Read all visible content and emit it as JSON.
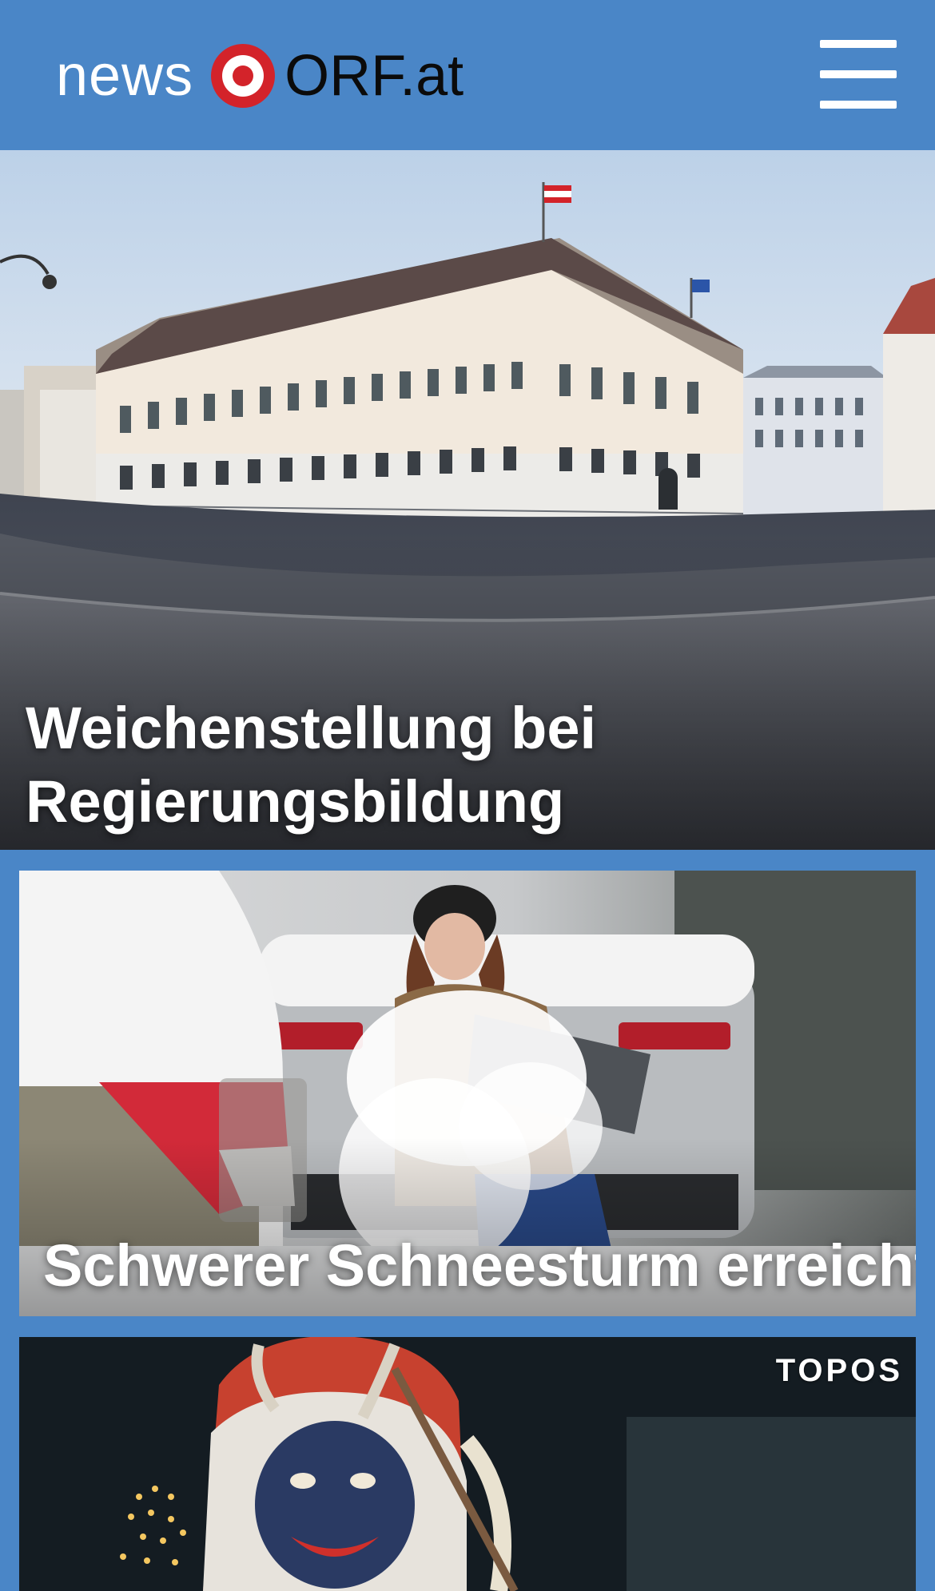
{
  "header": {
    "logo_word": "news",
    "logo_brand": "ORF.at",
    "menu_icon": "hamburger-menu-icon"
  },
  "colors": {
    "header_bg": "#4a86c7",
    "logo_red": "#d3232a",
    "text_white": "#ffffff"
  },
  "stories": {
    "lead": {
      "title_line1": "Weichenstellung bei",
      "title_line2": "Regierungsbildung"
    },
    "second": {
      "title": "Schwerer Schneesturm erreicht USA"
    },
    "third": {
      "badge": "TOPOS"
    }
  }
}
